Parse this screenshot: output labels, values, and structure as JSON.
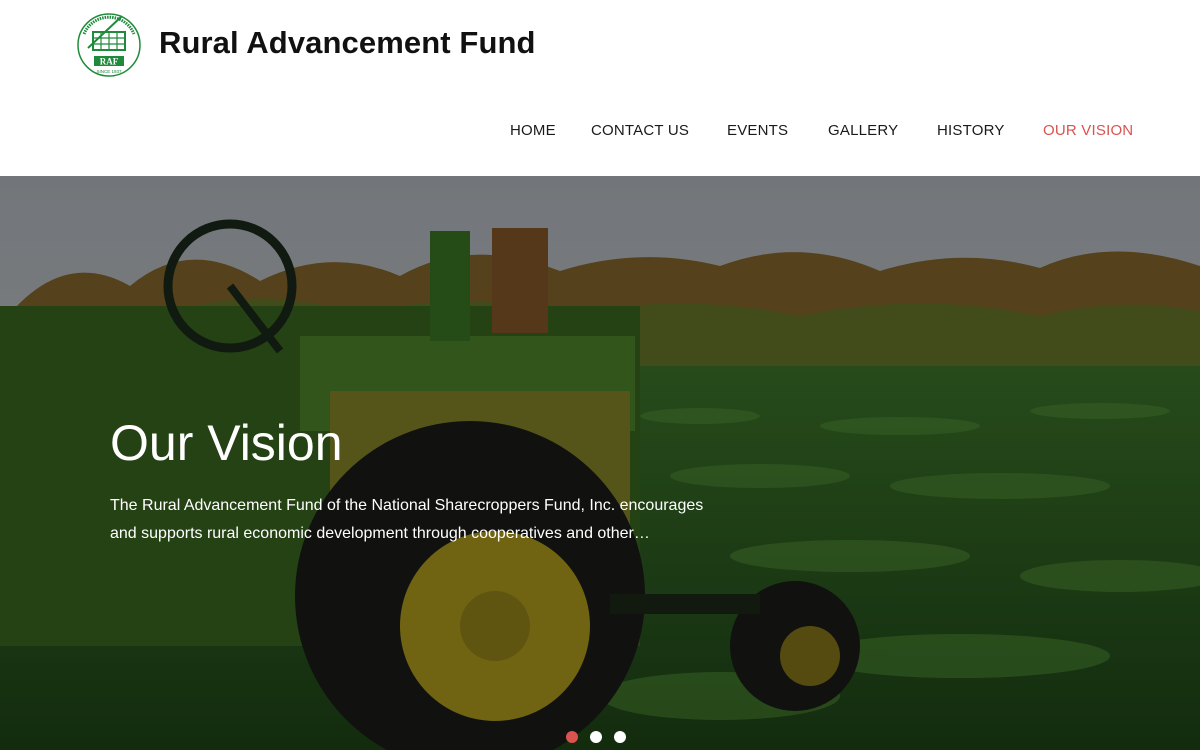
{
  "site": {
    "title": "Rural Advancement Fund",
    "logo_text": "RAF",
    "logo_since": "SINCE 1937"
  },
  "nav": {
    "items": [
      {
        "label": "HOME",
        "active": false
      },
      {
        "label": "CONTACT US",
        "active": false
      },
      {
        "label": "EVENTS",
        "active": false
      },
      {
        "label": "GALLERY",
        "active": false
      },
      {
        "label": "HISTORY",
        "active": false
      },
      {
        "label": "OUR VISION",
        "active": true
      }
    ]
  },
  "hero": {
    "title": "Our Vision",
    "text": "The Rural Advancement Fund of the National Sharecroppers Fund, Inc. encourages and supports rural economic development through cooperatives and other…",
    "slides": {
      "count": 3,
      "active_index": 0
    }
  },
  "colors": {
    "accent": "#d9534f",
    "logo_green": "#1f8a3b",
    "text_dark": "#111111"
  }
}
